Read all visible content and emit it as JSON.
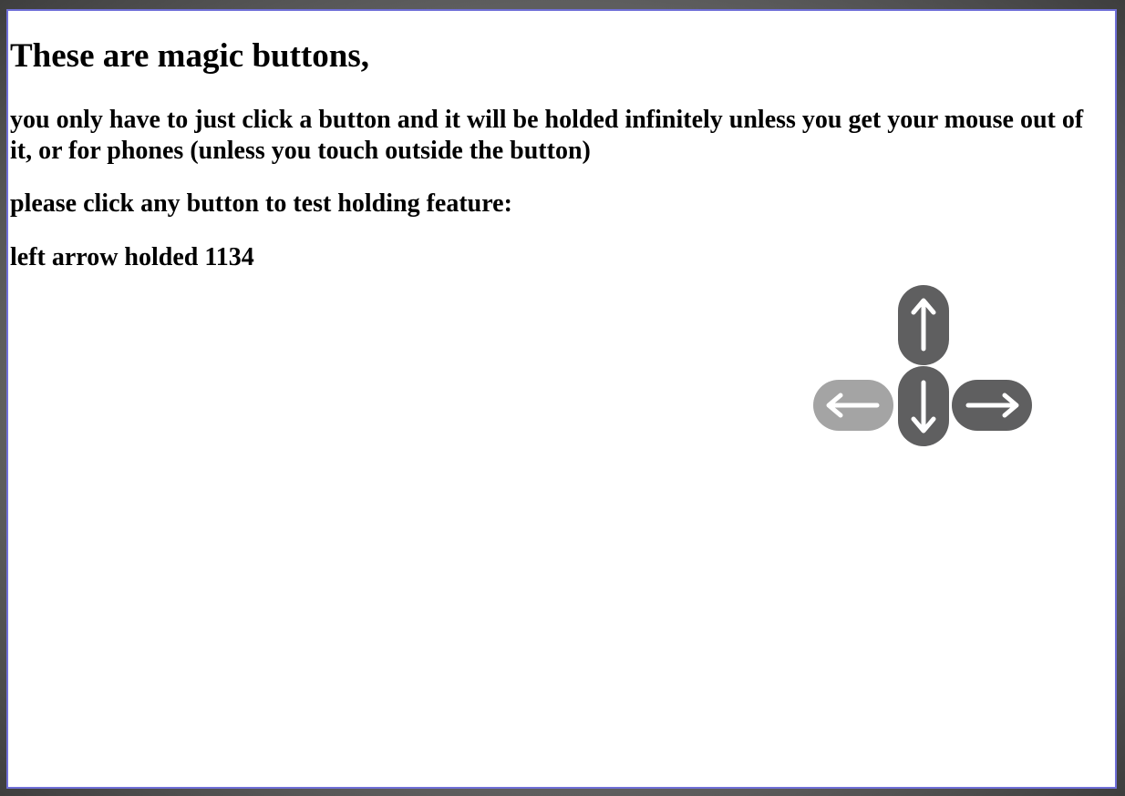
{
  "heading": "These are magic buttons,",
  "description": "you only have to just click a button and it will be holded infinitely unless you get your mouse out of it, or for phones (unless you touch outside the button)",
  "prompt": "please click any button to test holding feature:",
  "status": "left arrow holded 1134",
  "buttons": {
    "up": {
      "icon": "arrow-up-icon",
      "active": false
    },
    "down": {
      "icon": "arrow-down-icon",
      "active": false
    },
    "left": {
      "icon": "arrow-left-icon",
      "active": true
    },
    "right": {
      "icon": "arrow-right-icon",
      "active": false
    }
  },
  "colors": {
    "button": "#5f5f60",
    "button_active": "#a4a4a4",
    "arrow": "#ffffff",
    "frame_border": "#7070d8"
  }
}
